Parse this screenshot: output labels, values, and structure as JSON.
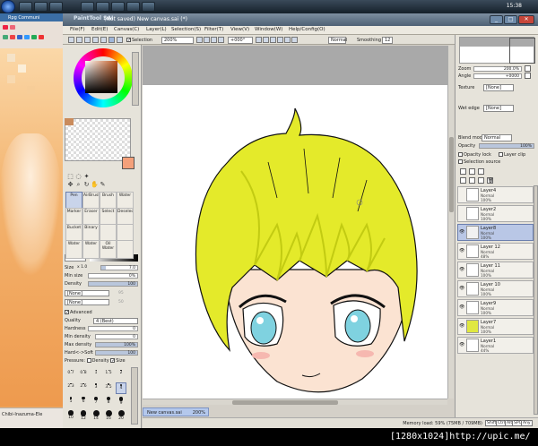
{
  "taskbar": {
    "clock": "15:38",
    "icons": [
      "chrome-icon",
      "firefox-icon",
      "folder-icon",
      "app-icon",
      "app-icon",
      "app-icon",
      "app-icon",
      "app-icon"
    ]
  },
  "browser": {
    "tab_label": "Rpg Communi",
    "status_text": "Chibi-Inazuma-Ele"
  },
  "window": {
    "app_logo": "PaintTool SAI",
    "title": "(Not saved) New canvas.sai (*)",
    "controls": [
      "_",
      "□",
      "✕"
    ]
  },
  "menu": [
    "File(F)",
    "Edit(E)",
    "Canvas(C)",
    "Layer(L)",
    "Selection(S)",
    "Filter(T)",
    "View(V)",
    "Window(W)",
    "Help/Config(O)"
  ],
  "toolbar": {
    "selection_label": "Selection",
    "zoom": "200%",
    "rotation": "+000°",
    "mode": "Normal",
    "smoothing_label": "Smoothing",
    "smoothing_value": "12"
  },
  "tools": [
    {
      "label": "Pen"
    },
    {
      "label": "AirBrush"
    },
    {
      "label": "Brush"
    },
    {
      "label": "Water"
    },
    {
      "label": "Marker"
    },
    {
      "label": "Eraser"
    },
    {
      "label": "Select"
    },
    {
      "label": "Deselect"
    },
    {
      "label": "Bucket"
    },
    {
      "label": "Binary"
    },
    {
      "label": "",
      "blank": true
    },
    {
      "label": "",
      "blank": true
    },
    {
      "label": "Water"
    },
    {
      "label": "Water"
    },
    {
      "label": "Oil Water"
    },
    {
      "label": "",
      "blank": true
    }
  ],
  "brush": {
    "blend_mode": "Normal",
    "size_label": "Size",
    "size_mult": "x 1.0",
    "size_value": "7.0",
    "size_pct": 0.12,
    "min_size_label": "Min size",
    "min_size_value": "0%",
    "min_size_pct": 0.0,
    "density_label": "Density",
    "density_value": "100",
    "density_pct": 1.0,
    "paper1": "[None]",
    "paper1_value": "95",
    "paper2": "[None]",
    "paper2_value": "50",
    "advanced_label": "Advanced",
    "quality_label": "Quality",
    "quality_value": "4 (Best)",
    "hardness_label": "Hardness",
    "hardness_value": "0",
    "hardness_pct": 0.0,
    "min_density_label": "Min density",
    "min_density_value": "0",
    "min_density_pct": 0.0,
    "max_density_label": "Max density",
    "max_density_value": "100%",
    "max_density_pct": 1.0,
    "hardsoft_label": "Hard<->Soft",
    "hardsoft_value": "100",
    "hardsoft_pct": 1.0,
    "pressure_label": "Pressure:",
    "pressure_density": "Density",
    "pressure_size": "Size"
  },
  "brush_sizes": [
    "0.7",
    "0.8",
    "1",
    "1.5",
    "2",
    "2.3",
    "2.6",
    "3",
    "3.5",
    "4",
    "5",
    "6",
    "7",
    "8",
    "9",
    "10",
    "12",
    "14",
    "16",
    "20"
  ],
  "canvas": {
    "file_tab": "New canvas.sai",
    "file_zoom": "200%"
  },
  "statusbar": {
    "memory": "Memory load: 59% (75MB / 709MB)",
    "keys": [
      "Shift",
      "Ctrl",
      "Alt",
      "SPC",
      "Any"
    ]
  },
  "navigator": {
    "zoom_label": "Zoom",
    "zoom_value": "200.0%",
    "angle_label": "Angle",
    "angle_value": "+0000"
  },
  "layer_props": {
    "texture_label": "Texture",
    "texture_value": "[None]",
    "wet_edge_label": "Wet edge",
    "wet_edge_value": "[None]",
    "blend_mode_label": "Blend mode",
    "blend_mode_value": "Normal",
    "opacity_label": "Opacity",
    "opacity_value": "100%",
    "opacity_lock_label": "Opacity lock",
    "layer_clip_label": "Layer clip",
    "selection_source_label": "Selection source"
  },
  "layers": [
    {
      "name": "Layer4",
      "mode": "Normal",
      "opacity": "100%",
      "visible": false,
      "selected": false,
      "thumb": "#ffffff"
    },
    {
      "name": "Layer2",
      "mode": "Normal",
      "opacity": "100%",
      "visible": false,
      "selected": false,
      "thumb": "#ffffff"
    },
    {
      "name": "Layer8",
      "mode": "Normal",
      "opacity": "100%",
      "visible": true,
      "selected": true,
      "thumb": "#f1f1f1"
    },
    {
      "name": "Layer 12",
      "mode": "Normal",
      "opacity": "48%",
      "visible": true,
      "selected": false,
      "thumb": "#ffffff"
    },
    {
      "name": "Layer 11",
      "mode": "Normal",
      "opacity": "100%",
      "visible": true,
      "selected": false,
      "thumb": "#ffffff"
    },
    {
      "name": "Layer 10",
      "mode": "Normal",
      "opacity": "100%",
      "visible": true,
      "selected": false,
      "thumb": "#ffffff"
    },
    {
      "name": "Layer9",
      "mode": "Normal",
      "opacity": "100%",
      "visible": true,
      "selected": false,
      "thumb": "#ffffff"
    },
    {
      "name": "Layer7",
      "mode": "Normal",
      "opacity": "100%",
      "visible": true,
      "selected": false,
      "thumb": "#e0e840"
    },
    {
      "name": "Layer1",
      "mode": "Normal",
      "opacity": "44%",
      "visible": true,
      "selected": false,
      "thumb": "#ffffff"
    }
  ],
  "caption": "[1280x1024]http://upic.me/",
  "colors": {
    "hair": "#e4ea2a",
    "hair_shade": "#c2cb12",
    "skin": "#fbe3d2",
    "eye": "#7fd2e0",
    "blush": "#f6b8b0",
    "foreground": "#f4a07a"
  }
}
